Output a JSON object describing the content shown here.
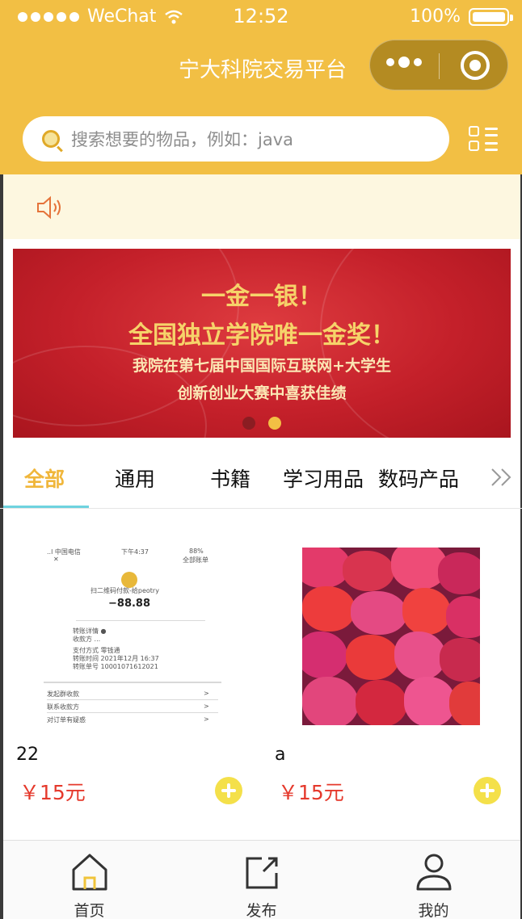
{
  "status_bar": {
    "carrier": "WeChat",
    "time": "12:52",
    "battery": "100%"
  },
  "nav": {
    "title": "宁大科院交易平台"
  },
  "search": {
    "placeholder": "搜索想要的物品，例如：java"
  },
  "banner": {
    "line1": "一金一银！",
    "line2": "全国独立学院唯一金奖！",
    "line3": "我院在第七届中国国际互联网+大学生",
    "line4": "创新创业大赛中喜获佳绩",
    "slides": 2,
    "active_slide": 2
  },
  "tabs": [
    {
      "label": "全部",
      "active": true
    },
    {
      "label": "通用",
      "active": false
    },
    {
      "label": "书籍",
      "active": false
    },
    {
      "label": "学习用品",
      "active": false
    },
    {
      "label": "数码产品",
      "active": false
    }
  ],
  "products": [
    {
      "name": "22",
      "price": "￥15元",
      "receipt": {
        "total": "−88.88",
        "rows": [
          "转账详情 ●",
          "收款方 ...",
          "支付方式 零钱通",
          "转账时间 2021年12月 16:37",
          "转账单号 10001071612021"
        ],
        "links": [
          "发起群收款",
          "联系收款方",
          "对订单有疑惑"
        ]
      }
    },
    {
      "name": "a",
      "price": "￥15元"
    }
  ],
  "tabbar": [
    {
      "label": "首页",
      "icon": "home-icon",
      "active": true
    },
    {
      "label": "发布",
      "icon": "publish-icon",
      "active": false
    },
    {
      "label": "我的",
      "icon": "user-icon",
      "active": false
    }
  ],
  "colors": {
    "header_yellow": "#f2bf44",
    "price_red": "#e5392c",
    "active_tab": "#f0b63a",
    "notice_bg": "#fdf7e0",
    "add_button": "#f4e04a"
  }
}
